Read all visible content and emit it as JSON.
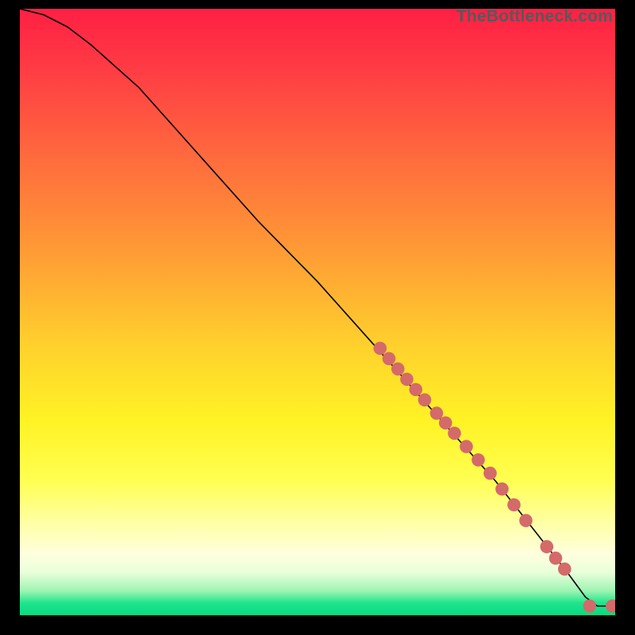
{
  "watermark": "TheBottleneck.com",
  "chart_data": {
    "type": "line",
    "title": "",
    "xlabel": "",
    "ylabel": "",
    "xlim": [
      0,
      100
    ],
    "ylim": [
      0,
      100
    ],
    "curve": {
      "x": [
        0,
        4,
        8,
        12,
        20,
        30,
        40,
        50,
        60,
        70,
        80,
        88,
        92,
        95,
        97,
        100
      ],
      "y": [
        100,
        99,
        97,
        94,
        87,
        76,
        65,
        55,
        44,
        33,
        22,
        12,
        7,
        3,
        1.5,
        1.5
      ]
    },
    "series": [
      {
        "name": "points-upper",
        "type": "scatter",
        "color": "#d46a6a",
        "radius_pct": 1.1,
        "points": [
          {
            "x": 60.5,
            "y": 44.0
          },
          {
            "x": 62.0,
            "y": 42.3
          },
          {
            "x": 63.5,
            "y": 40.6
          },
          {
            "x": 65.0,
            "y": 38.9
          },
          {
            "x": 66.5,
            "y": 37.2
          },
          {
            "x": 68.0,
            "y": 35.5
          },
          {
            "x": 70.0,
            "y": 33.3
          },
          {
            "x": 71.5,
            "y": 31.7
          },
          {
            "x": 73.0,
            "y": 30.0
          },
          {
            "x": 75.0,
            "y": 27.8
          },
          {
            "x": 77.0,
            "y": 25.6
          },
          {
            "x": 79.0,
            "y": 23.4
          },
          {
            "x": 81.0,
            "y": 20.8
          },
          {
            "x": 83.0,
            "y": 18.2
          },
          {
            "x": 85.0,
            "y": 15.6
          }
        ]
      },
      {
        "name": "points-lower",
        "type": "scatter",
        "color": "#d46a6a",
        "radius_pct": 1.1,
        "points": [
          {
            "x": 88.5,
            "y": 11.3
          },
          {
            "x": 90.0,
            "y": 9.4
          },
          {
            "x": 91.5,
            "y": 7.6
          }
        ]
      },
      {
        "name": "points-bottom",
        "type": "scatter",
        "color": "#d46a6a",
        "radius_pct": 1.1,
        "points": [
          {
            "x": 95.7,
            "y": 1.5
          },
          {
            "x": 99.5,
            "y": 1.5
          }
        ]
      }
    ]
  }
}
